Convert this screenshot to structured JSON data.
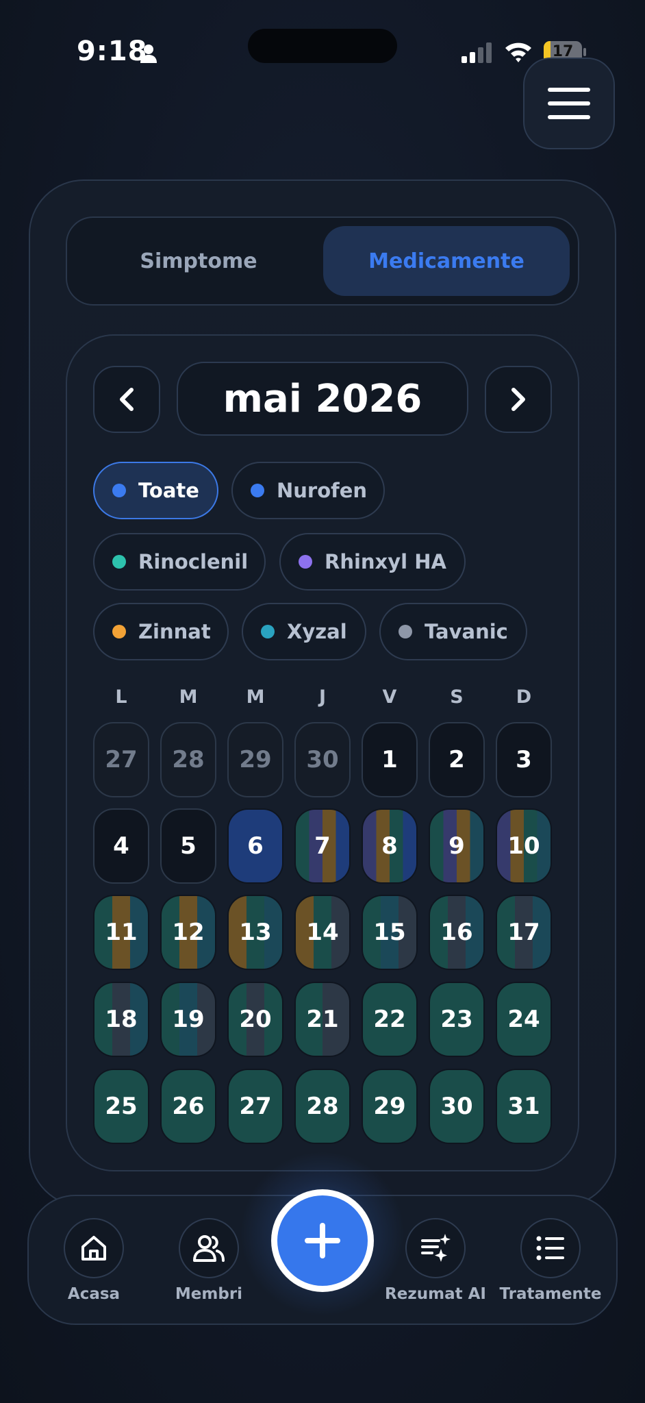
{
  "status_bar": {
    "time": "9:18",
    "battery": "17",
    "battery_fraction": 0.17
  },
  "tabs": {
    "left": "Simptome",
    "right": "Medicamente",
    "active": "Medicamente"
  },
  "calendar": {
    "month_label": "mai 2026",
    "weekdays": [
      "L",
      "M",
      "M",
      "J",
      "V",
      "S",
      "D"
    ],
    "days": [
      {
        "n": "27",
        "muted": true
      },
      {
        "n": "28",
        "muted": true
      },
      {
        "n": "29",
        "muted": true
      },
      {
        "n": "30",
        "muted": true
      },
      {
        "n": "1"
      },
      {
        "n": "2"
      },
      {
        "n": "3"
      },
      {
        "n": "4"
      },
      {
        "n": "5"
      },
      {
        "n": "6",
        "meds": [
          "nurofen"
        ]
      },
      {
        "n": "7",
        "meds": [
          "rinoclenil",
          "rhinxyl",
          "zinnat",
          "nurofen"
        ]
      },
      {
        "n": "8",
        "meds": [
          "rhinxyl",
          "zinnat",
          "rinoclenil",
          "nurofen"
        ]
      },
      {
        "n": "9",
        "meds": [
          "rinoclenil",
          "rhinxyl",
          "zinnat",
          "xyzal"
        ]
      },
      {
        "n": "10",
        "meds": [
          "rhinxyl",
          "zinnat",
          "rinoclenil",
          "xyzal"
        ]
      },
      {
        "n": "11",
        "meds": [
          "rinoclenil",
          "zinnat",
          "xyzal"
        ]
      },
      {
        "n": "12",
        "meds": [
          "rinoclenil",
          "zinnat",
          "xyzal"
        ]
      },
      {
        "n": "13",
        "meds": [
          "zinnat",
          "rinoclenil",
          "xyzal"
        ]
      },
      {
        "n": "14",
        "meds": [
          "zinnat",
          "rinoclenil",
          "tavanic"
        ]
      },
      {
        "n": "15",
        "meds": [
          "rinoclenil",
          "xyzal",
          "tavanic"
        ]
      },
      {
        "n": "16",
        "meds": [
          "rinoclenil",
          "tavanic",
          "xyzal"
        ]
      },
      {
        "n": "17",
        "meds": [
          "rinoclenil",
          "tavanic",
          "xyzal"
        ]
      },
      {
        "n": "18",
        "meds": [
          "rinoclenil",
          "tavanic",
          "xyzal"
        ]
      },
      {
        "n": "19",
        "meds": [
          "rinoclenil",
          "xyzal",
          "tavanic"
        ]
      },
      {
        "n": "20",
        "meds": [
          "rinoclenil",
          "tavanic",
          "rinoclenil"
        ]
      },
      {
        "n": "21",
        "meds": [
          "rinoclenil",
          "tavanic"
        ]
      },
      {
        "n": "22",
        "meds": [
          "rinoclenil"
        ]
      },
      {
        "n": "23",
        "meds": [
          "rinoclenil"
        ]
      },
      {
        "n": "24",
        "meds": [
          "rinoclenil"
        ]
      },
      {
        "n": "25",
        "meds": [
          "rinoclenil"
        ]
      },
      {
        "n": "26",
        "meds": [
          "rinoclenil"
        ]
      },
      {
        "n": "27",
        "meds": [
          "rinoclenil"
        ]
      },
      {
        "n": "28",
        "meds": [
          "rinoclenil"
        ]
      },
      {
        "n": "29",
        "meds": [
          "rinoclenil"
        ]
      },
      {
        "n": "30",
        "meds": [
          "rinoclenil"
        ]
      },
      {
        "n": "31",
        "meds": [
          "rinoclenil"
        ]
      }
    ]
  },
  "filters": [
    {
      "id": "toate",
      "label": "Toate",
      "color": "#3b7bf0",
      "active": true
    },
    {
      "id": "nurofen",
      "label": "Nurofen",
      "color": "#3b7bf0",
      "active": false
    },
    {
      "id": "rinoclenil",
      "label": "Rinoclenil",
      "color": "#2dc2ad",
      "active": false
    },
    {
      "id": "rhinxyl",
      "label": "Rhinxyl HA",
      "color": "#8d72ee",
      "active": false
    },
    {
      "id": "zinnat",
      "label": "Zinnat",
      "color": "#f2a236",
      "active": false
    },
    {
      "id": "xyzal",
      "label": "Xyzal",
      "color": "#2aa3c0",
      "active": false
    },
    {
      "id": "tavanic",
      "label": "Tavanic",
      "color": "#8e97a8",
      "active": false
    }
  ],
  "stripe_colors": {
    "nurofen": "#1e3c7a",
    "rinoclenil": "#1a4d4a",
    "rhinxyl": "#363a6c",
    "zinnat": "#6b5226",
    "xyzal": "#1b4858",
    "tavanic": "#2d3846"
  },
  "bottom_nav": {
    "home": "Acasa",
    "members": "Membri",
    "summary": "Rezumat AI",
    "treatments": "Tratamente"
  },
  "colors": {
    "accent": "#3677ec",
    "background": "#111826"
  }
}
